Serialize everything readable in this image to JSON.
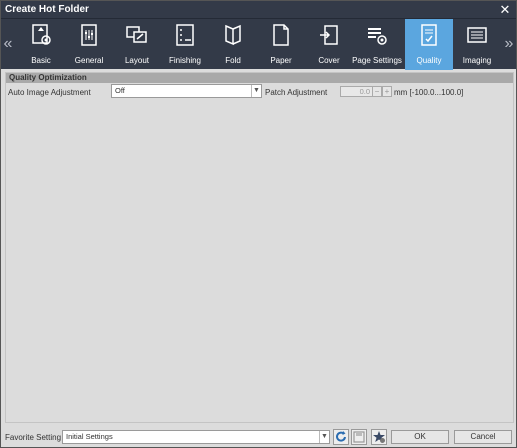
{
  "window": {
    "title": "Create Hot Folder"
  },
  "tabs": [
    {
      "label": "Basic",
      "icon": "basic-icon"
    },
    {
      "label": "General",
      "icon": "general-icon"
    },
    {
      "label": "Layout",
      "icon": "layout-icon"
    },
    {
      "label": "Finishing",
      "icon": "finishing-icon"
    },
    {
      "label": "Fold",
      "icon": "fold-icon"
    },
    {
      "label": "Paper",
      "icon": "paper-icon"
    },
    {
      "label": "Cover",
      "icon": "cover-icon"
    },
    {
      "label": "Page Settings",
      "icon": "page-settings-icon"
    },
    {
      "label": "Quality",
      "icon": "quality-icon",
      "active": true
    },
    {
      "label": "Imaging",
      "icon": "imaging-icon"
    }
  ],
  "section": {
    "title": "Quality Optimization"
  },
  "auto_image": {
    "label": "Auto Image Adjustment",
    "value": "Off"
  },
  "patch": {
    "label": "Patch Adjustment",
    "value": "0.0",
    "minus": "−",
    "plus": "+",
    "unit": "mm [-100.0...100.0]"
  },
  "footer": {
    "favorite_label": "Favorite Setting",
    "favorite_value": "Initial Settings",
    "ok": "OK",
    "cancel": "Cancel"
  },
  "colors": {
    "titlebar": "#333a48",
    "active_tab": "#5ba6df",
    "section_header": "#a9a9a9"
  }
}
